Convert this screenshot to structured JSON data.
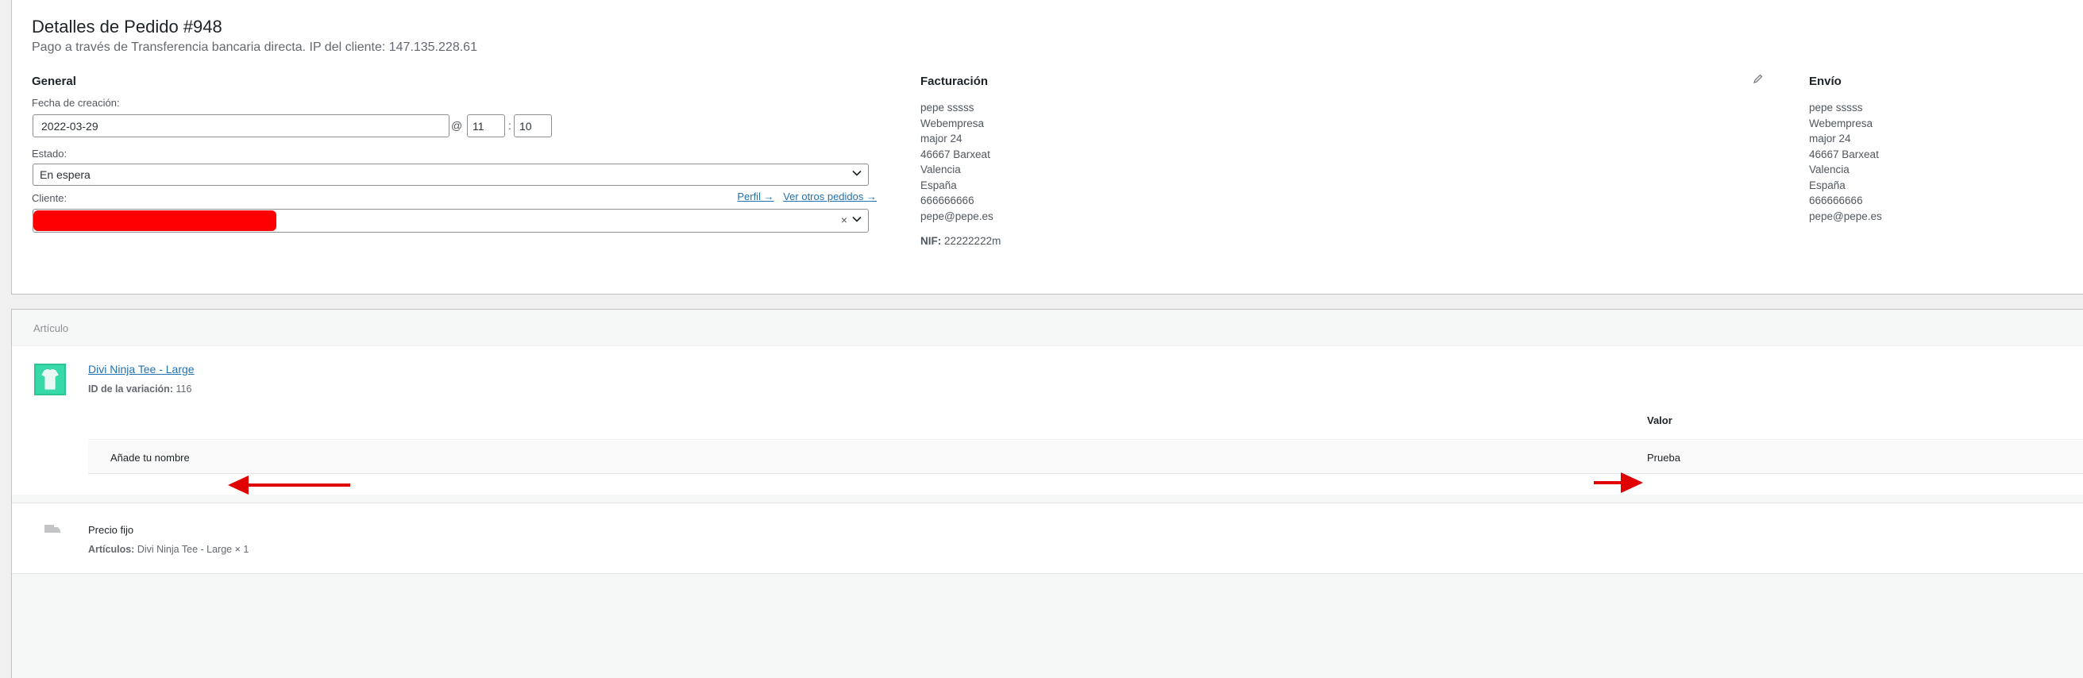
{
  "order": {
    "title": "Detalles de Pedido #948",
    "subtitle": "Pago a través de Transferencia bancaria directa. IP del cliente: 147.135.228.61"
  },
  "general": {
    "heading": "General",
    "date_label": "Fecha de creación:",
    "date_value": "2022-03-29",
    "at_sign": "@",
    "hour_value": "11",
    "colon": ":",
    "minute_value": "10",
    "status_label": "Estado:",
    "status_value": "En espera",
    "customer_label": "Cliente:",
    "profile_link": "Perfil →",
    "other_orders_link": "Ver otros pedidos →",
    "clear_symbol": "×"
  },
  "billing": {
    "heading": "Facturación",
    "lines": [
      "pepe sssss",
      "Webempresa",
      "major 24",
      "46667 Barxeat",
      "Valencia",
      "España",
      "666666666",
      "pepe@pepe.es"
    ],
    "nif_label": "NIF:",
    "nif_value": "22222222m",
    "edit_icon": "pencil-icon"
  },
  "shipping": {
    "heading": "Envío",
    "lines": [
      "pepe sssss",
      "Webempresa",
      "major 24",
      "46667 Barxeat",
      "Valencia",
      "España",
      "666666666",
      "pepe@pepe.es"
    ]
  },
  "items": {
    "header": "Artículo",
    "product": {
      "name": "Divi Ninja Tee - Large",
      "variation_label": "ID de la variación:",
      "variation_id": "116",
      "meta_value_header": "Valor",
      "meta_key": "Añade tu nombre",
      "meta_value": "Prueba"
    },
    "shipping_line": {
      "name": "Precio fijo",
      "items_label": "Artículos:",
      "items_value": "Divi Ninja Tee - Large × 1"
    }
  },
  "colors": {
    "link": "#2271b1",
    "annotation_red": "#e00000",
    "redaction": "#ff0000"
  }
}
